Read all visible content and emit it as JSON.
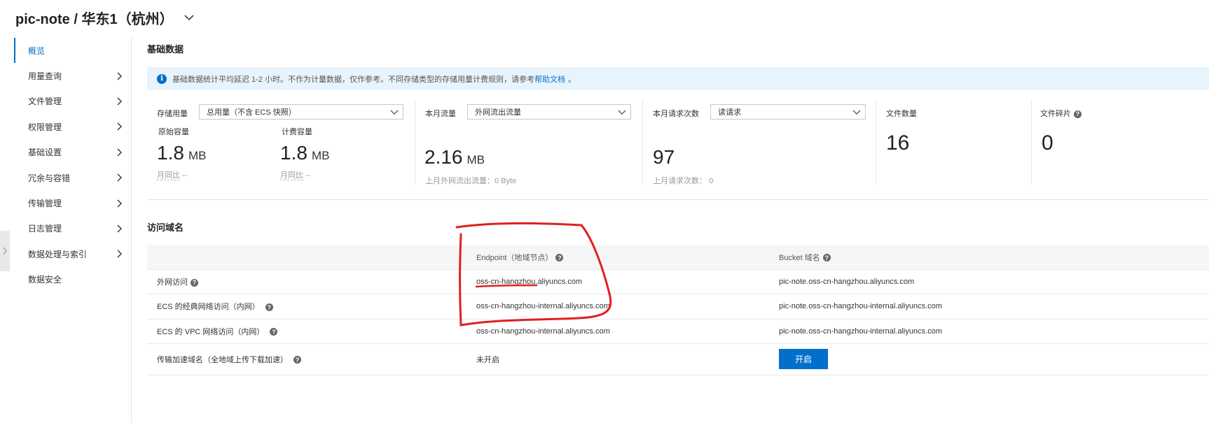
{
  "header": {
    "title": "pic-note / 华东1（杭州）"
  },
  "sidebar": {
    "items": [
      {
        "label": "概览",
        "active": true,
        "has_arrow": false
      },
      {
        "label": "用量查询",
        "has_arrow": true
      },
      {
        "label": "文件管理",
        "has_arrow": true
      },
      {
        "label": "权限管理",
        "has_arrow": true
      },
      {
        "label": "基础设置",
        "has_arrow": true
      },
      {
        "label": "冗余与容错",
        "has_arrow": true
      },
      {
        "label": "传输管理",
        "has_arrow": true
      },
      {
        "label": "日志管理",
        "has_arrow": true
      },
      {
        "label": "数据处理与索引",
        "has_arrow": true
      },
      {
        "label": "数据安全",
        "has_arrow": false
      }
    ]
  },
  "basic": {
    "title": "基础数据",
    "notice_text": "基础数据统计平均延迟 1-2 小时。不作为计量数据，仅作参考。不同存储类型的存储用量计费规则，请参考",
    "notice_link": "帮助文档",
    "notice_end": "。",
    "storage": {
      "label": "存储用量",
      "select": "总用量（不含 ECS 快照）",
      "raw_label": "原始容量",
      "raw_value": "1.8",
      "raw_unit": "MB",
      "raw_mom": "月同比",
      "raw_mom_val": "--",
      "bill_label": "计费容量",
      "bill_value": "1.8",
      "bill_unit": "MB",
      "bill_mom": "月同比",
      "bill_mom_val": "--"
    },
    "traffic": {
      "label": "本月流量",
      "select": "外网流出流量",
      "value": "2.16",
      "unit": "MB",
      "prev": "上月外网流出流量：0 Byte"
    },
    "requests": {
      "label": "本月请求次数",
      "select": "读请求",
      "value": "97",
      "prev_label": "上月请求次数：",
      "prev_value": "0"
    },
    "files": {
      "label": "文件数量",
      "value": "16"
    },
    "fragments": {
      "label": "文件碎片",
      "value": "0"
    }
  },
  "domains": {
    "title": "访问域名",
    "headers": [
      "",
      "Endpoint（地域节点）",
      "Bucket 域名"
    ],
    "rows": [
      {
        "name": "外网访问",
        "endpoint": "oss-cn-hangzhou.aliyuncs.com",
        "bucket": "pic-note.oss-cn-hangzhou.aliyuncs.com"
      },
      {
        "name": "ECS 的经典网络访问（内网）",
        "endpoint": "oss-cn-hangzhou-internal.aliyuncs.com",
        "bucket": "pic-note.oss-cn-hangzhou-internal.aliyuncs.com"
      },
      {
        "name": "ECS 的 VPC 网络访问（内网）",
        "endpoint": "oss-cn-hangzhou-internal.aliyuncs.com",
        "bucket": "pic-note.oss-cn-hangzhou-internal.aliyuncs.com"
      }
    ],
    "accel": {
      "name": "传输加速域名（全地域上传下载加速）",
      "status": "未开启",
      "button": "开启"
    }
  },
  "colors": {
    "accent": "#0070cc",
    "annotation": "#e02020",
    "notice_bg": "#e8f4fd"
  },
  "icons": {
    "info": "info-icon",
    "help": "help-icon",
    "chevron": "chevron-right-icon",
    "dropdown": "chevron-down-icon"
  }
}
